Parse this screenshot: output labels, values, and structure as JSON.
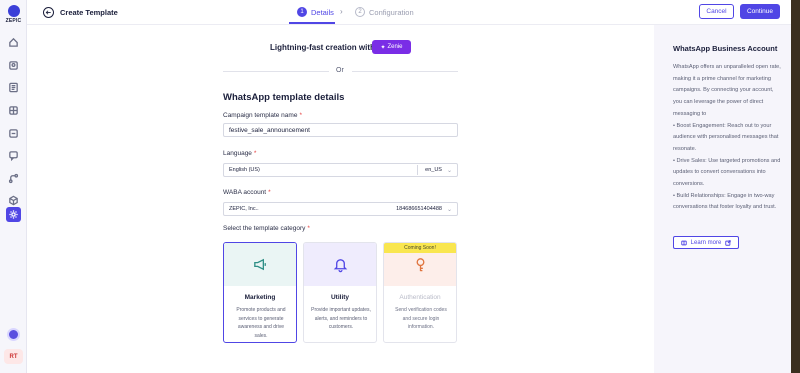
{
  "brand": {
    "logo_text": "ZEPIC"
  },
  "header": {
    "title": "Create Template",
    "steps": [
      {
        "num": "1",
        "label": "Details"
      },
      {
        "num": "2",
        "label": "Configuration"
      }
    ],
    "cancel_label": "Cancel",
    "continue_label": "Continue"
  },
  "user": {
    "initials": "RT"
  },
  "main": {
    "lightning_text": "Lightning-fast creation with",
    "zenie_label": "Zenie",
    "or_text": "Or",
    "section_title": "WhatsApp template details",
    "name_label": "Campaign template name",
    "name_value": "festive_sale_announcement",
    "language_label": "Language",
    "language_value": "English (US)",
    "language_code": "en_US",
    "waba_label": "WABA account",
    "waba_value": "ZEPIC, Inc..",
    "waba_id": "184686651404488",
    "category_label": "Select the template category",
    "required_mark": "*"
  },
  "categories": [
    {
      "title": "Marketing",
      "desc": "Promote products and services to generate awareness and drive sales.",
      "icon": "megaphone-icon",
      "bg": "#eaf5f4",
      "color": "#2e8f86"
    },
    {
      "title": "Utility",
      "desc": "Provide important updates, alerts, and reminders to customers.",
      "icon": "bell-icon",
      "bg": "#efecfd",
      "color": "#5046e5"
    },
    {
      "title": "Authentication",
      "desc": "Send verification codes and secure login information.",
      "icon": "key-icon",
      "bg": "#fdeeea",
      "color": "#e0743e",
      "badge": "Coming Soon!"
    }
  ],
  "info": {
    "title": "WhatsApp Business Account",
    "lines": [
      "WhatsApp offers an unparalleled open rate, making it a prime channel for marketing campaigns. By connecting your account, you can leverage the power of direct messaging to",
      "• Boost Engagement: Reach out to your audience with personalised messages that resonate.",
      "• Drive Sales: Use targeted promotions and updates to convert conversations into conversions.",
      "• Build Relationships: Engage in two-way conversations that foster loyalty and trust."
    ],
    "learn_more": "Learn more"
  },
  "colors": {
    "accent": "#5046e5",
    "zenie": "#7a2de6",
    "badge": "#f9e64f"
  }
}
